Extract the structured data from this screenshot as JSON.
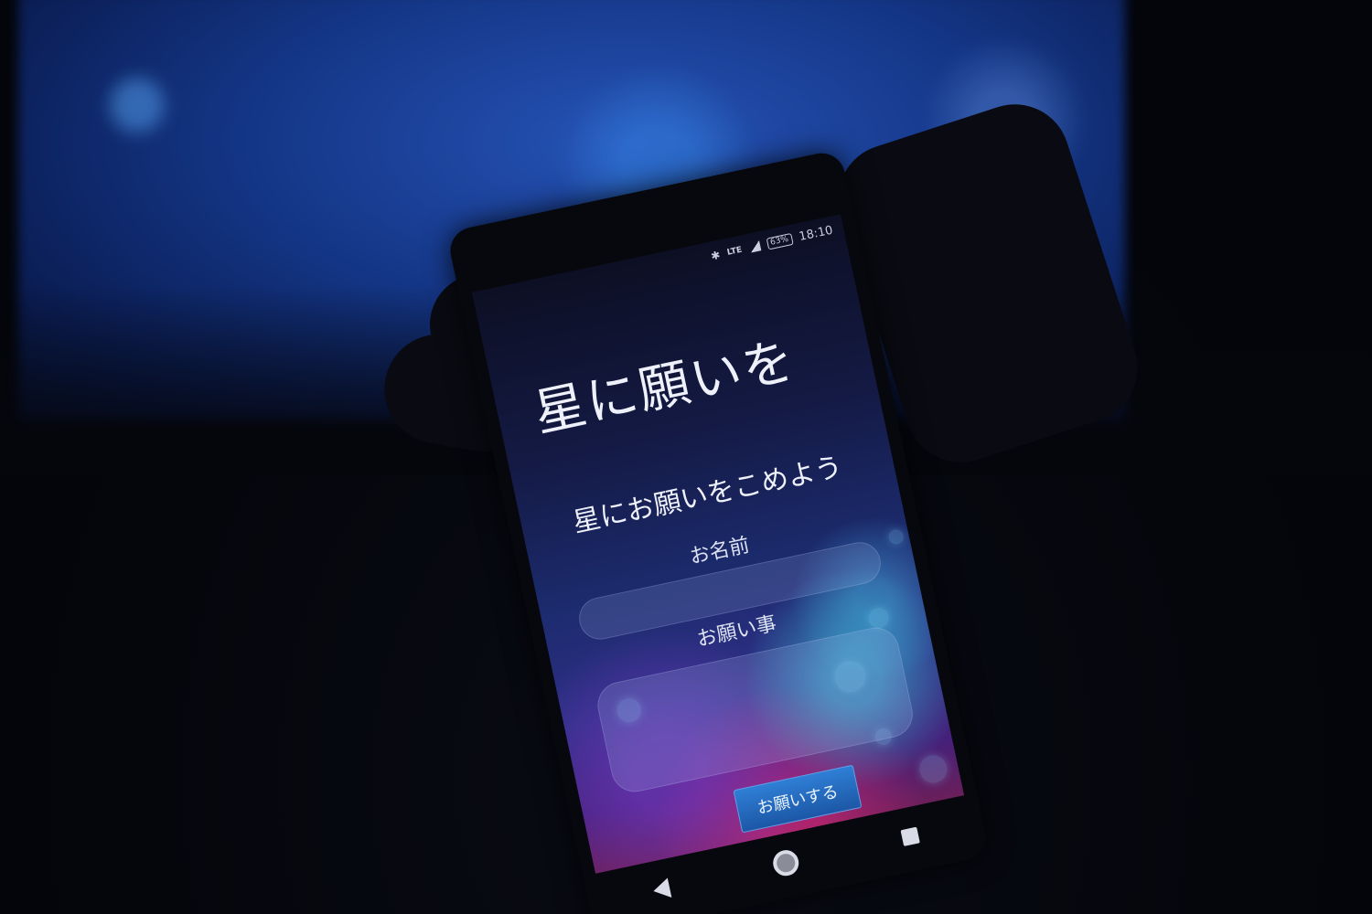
{
  "background": {
    "projection_text_1": "",
    "projection_text_2": ""
  },
  "status_bar": {
    "lte": "LTE",
    "battery": "63%",
    "time": "18:10"
  },
  "app": {
    "title": "星に願いを",
    "subtitle": "星にお願いをこめよう",
    "name_label": "お名前",
    "wish_label": "お願い事",
    "submit_label": "お願いする"
  },
  "icons": {
    "bluetooth": "bluetooth-icon",
    "signal": "signal-icon",
    "battery": "battery-icon",
    "back": "nav-back-icon",
    "home": "nav-home-icon",
    "recent": "nav-recent-icon"
  },
  "colors": {
    "button": "#2f7fd6",
    "screen_top": "#0d0f24",
    "screen_bottom": "#6a1f5a",
    "projection": "#2a5cc9"
  }
}
